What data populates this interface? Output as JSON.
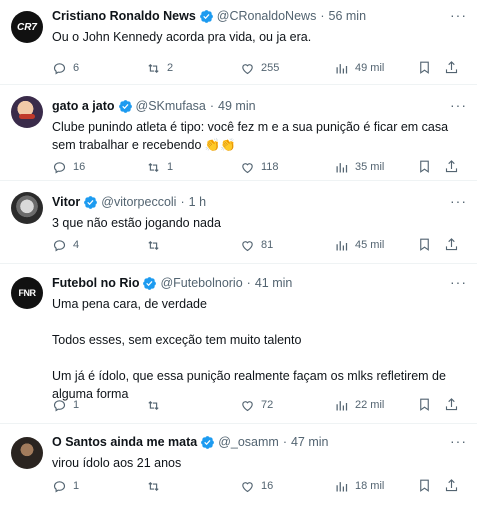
{
  "colors": {
    "verified": "#1d9bf0",
    "muted": "#536471",
    "border": "#eff3f4",
    "text": "#0f1419"
  },
  "tweets": [
    {
      "name": "Cristiano Ronaldo News",
      "handle": "@CRonaldoNews",
      "sep": "·",
      "time": "56 min",
      "text": "Ou o John Kennedy acorda pra vida, ou ja era.",
      "replies": "6",
      "retweets": "2",
      "likes": "255",
      "views": "49 mil",
      "avatar_icon": "cr7-logo",
      "avatar_text": "CR7"
    },
    {
      "name": "gato a jato",
      "handle": "@SKmufasa",
      "sep": "·",
      "time": "49 min",
      "text": "Clube punindo atleta é tipo: você fez m       e a sua punição é ficar em casa sem trabalhar e recebendo 👏👏",
      "replies": "16",
      "retweets": "1",
      "likes": "118",
      "views": "35 mil",
      "avatar_icon": "cartoon-avatar"
    },
    {
      "name": "Vitor",
      "handle": "@vitorpeccoli",
      "sep": "·",
      "time": "1 h",
      "text": "3 que não estão jogando nada",
      "replies": "4",
      "retweets": "",
      "likes": "81",
      "views": "45 mil",
      "avatar_icon": "person-photo"
    },
    {
      "name": "Futebol no Rio",
      "handle": "@Futebolnorio",
      "sep": "·",
      "time": "41 min",
      "text": "Uma pena cara, de verdade\n\nTodos esses, sem exceção tem muito talento\n\nUm já é ídolo, que essa punição realmente façam os mlks refletirem de alguma forma",
      "replies": "1",
      "retweets": "",
      "likes": "72",
      "views": "22 mil",
      "avatar_icon": "fnr-logo",
      "avatar_text": "FNR"
    },
    {
      "name": "O Santos ainda me mata",
      "handle": "@_osamm",
      "sep": "·",
      "time": "47 min",
      "text": "virou ídolo aos 21 anos",
      "replies": "1",
      "retweets": "",
      "likes": "16",
      "views": "18 mil",
      "avatar_icon": "person-photo"
    }
  ]
}
